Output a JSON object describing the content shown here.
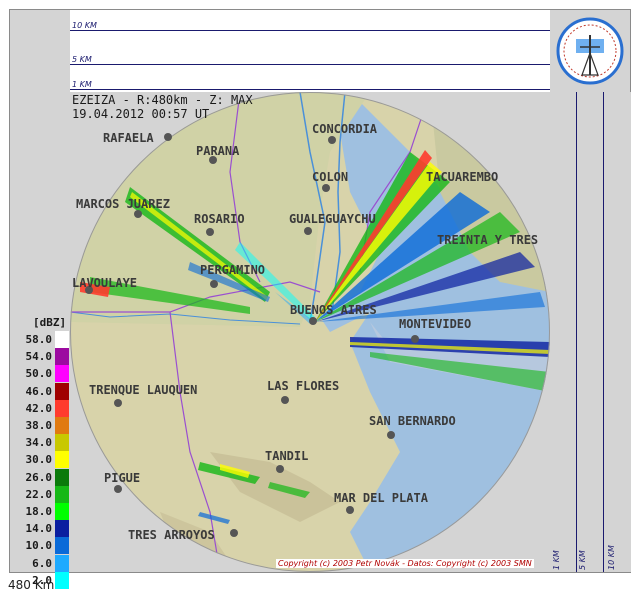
{
  "header": {
    "line1": "EZEIZA - R:480km - Z: MAX",
    "line2": "19.04.2012 00:57 UT"
  },
  "altitude_scale": [
    "10 KM",
    "5 KM",
    "1 KM"
  ],
  "side_scale": [
    "1 KM",
    "5 KM",
    "10 KM"
  ],
  "legend": {
    "title": "[dBZ]",
    "entries": [
      {
        "label": "58.0",
        "color": "#ffffff"
      },
      {
        "label": "54.0",
        "color": "#9c0aa0"
      },
      {
        "label": "50.0",
        "color": "#ff00ff"
      },
      {
        "label": "46.0",
        "color": "#a00000"
      },
      {
        "label": "42.0",
        "color": "#ff3b2e"
      },
      {
        "label": "38.0",
        "color": "#e07a10"
      },
      {
        "label": "34.0",
        "color": "#c8c800"
      },
      {
        "label": "30.0",
        "color": "#ffff00"
      },
      {
        "label": "26.0",
        "color": "#0a7a0a"
      },
      {
        "label": "22.0",
        "color": "#16b816"
      },
      {
        "label": "18.0",
        "color": "#00ff00"
      },
      {
        "label": "14.0",
        "color": "#0a1ea0"
      },
      {
        "label": "10.0",
        "color": "#0a6ad8"
      },
      {
        "label": "6.0",
        "color": "#1eaaff"
      },
      {
        "label": "2.0",
        "color": "#00ffff"
      }
    ]
  },
  "cities": [
    {
      "name": "RAFAELA"
    },
    {
      "name": "PARANA"
    },
    {
      "name": "CONCORDIA"
    },
    {
      "name": "COLON"
    },
    {
      "name": "TACUAREMBO"
    },
    {
      "name": "MARCOS JUAREZ"
    },
    {
      "name": "ROSARIO"
    },
    {
      "name": "GUALEGUAYCHU"
    },
    {
      "name": "TREINTA Y TRES"
    },
    {
      "name": "PERGAMINO"
    },
    {
      "name": "LAVOULAYE"
    },
    {
      "name": "BUENOS AIRES"
    },
    {
      "name": "MONTEVIDEO"
    },
    {
      "name": "TRENQUE LAUQUEN"
    },
    {
      "name": "LAS FLORES"
    },
    {
      "name": "SAN BERNARDO"
    },
    {
      "name": "TANDIL"
    },
    {
      "name": "PIGUE"
    },
    {
      "name": "MAR DEL PLATA"
    },
    {
      "name": "TRES ARROYOS"
    }
  ],
  "copyright": "Copyright (c) 2003 Petr Novák - Datos: Copyright (c) 2003 SMN",
  "range_label": "480 Km",
  "colors": {
    "land": "#ddd6b0",
    "sea": "#8fb6de",
    "border": "#9a4fd0",
    "river": "#4a90d9"
  }
}
